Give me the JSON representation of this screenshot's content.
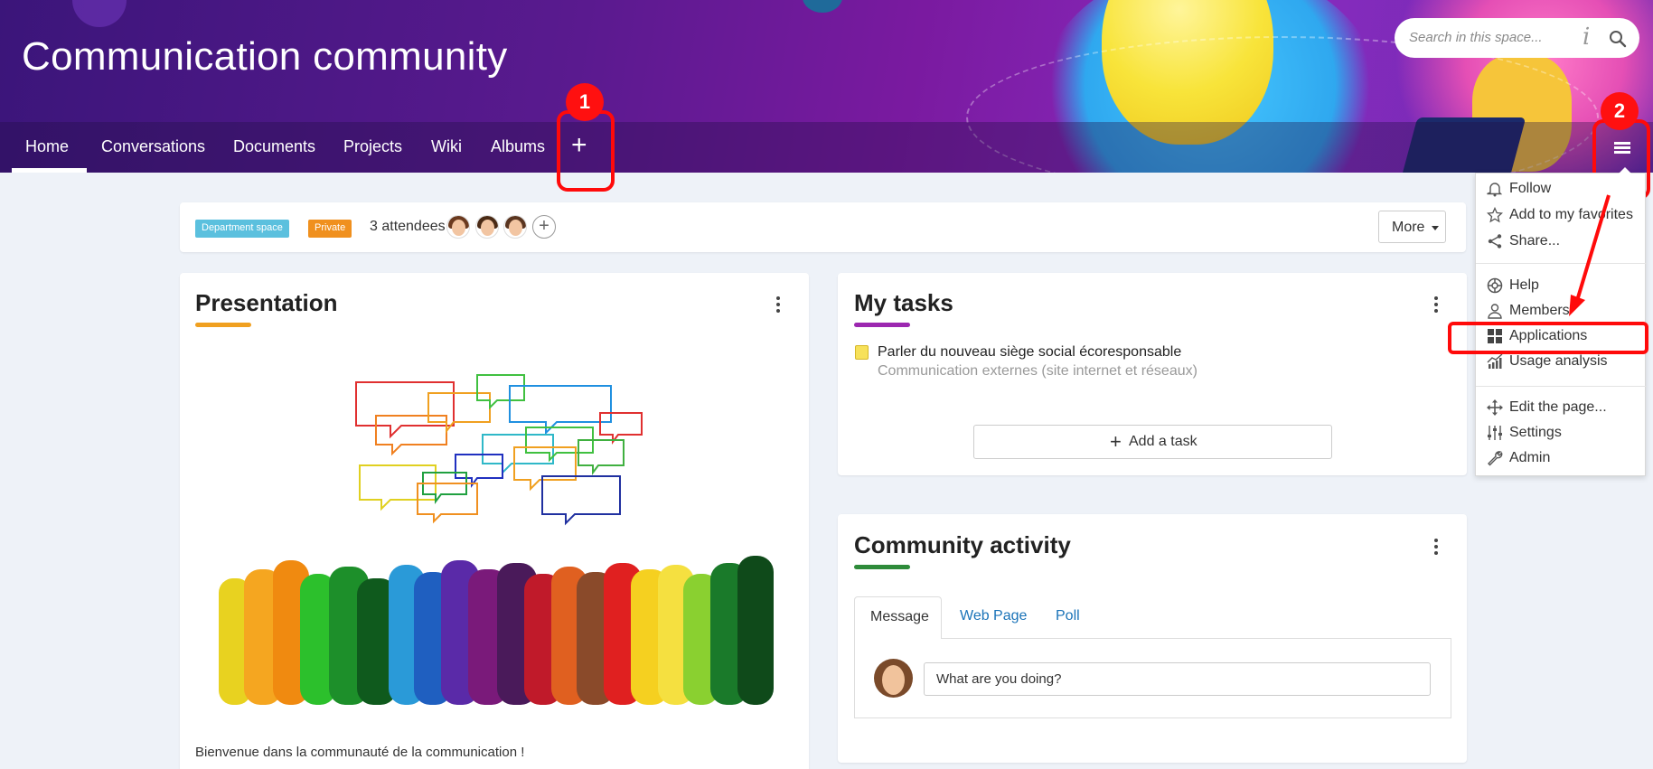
{
  "header": {
    "title": "Communication community",
    "search_placeholder": "Search in this space..."
  },
  "nav": {
    "tabs": [
      "Home",
      "Conversations",
      "Documents",
      "Projects",
      "Wiki",
      "Albums"
    ],
    "add_label": "+",
    "active": "Home"
  },
  "annotations": {
    "one": "1",
    "two": "2",
    "color": "#ff0a0a"
  },
  "info_bar": {
    "tags": [
      {
        "label": "Department space",
        "color": "#5bc0de"
      },
      {
        "label": "Private",
        "color": "#f0901e"
      }
    ],
    "attendees": "3 attendees",
    "add_attendee": "+",
    "more_label": "More"
  },
  "presentation": {
    "title": "Presentation",
    "underline_color": "#f0a020",
    "welcome": "Bienvenue dans la communauté de la communication !"
  },
  "tasks": {
    "title": "My tasks",
    "underline_color": "#9c27b0",
    "items": [
      {
        "title": "Parler du nouveau siège social écoresponsable",
        "subtitle": "Communication externes (site internet et réseaux)"
      }
    ],
    "add_label": "Add a task"
  },
  "activity": {
    "title": "Community activity",
    "underline_color": "#2e8b3a",
    "tabs": [
      "Message",
      "Web Page",
      "Poll"
    ],
    "compose_placeholder": "What are you doing?"
  },
  "menu": {
    "items": [
      {
        "label": "Follow",
        "icon": "bell-icon"
      },
      {
        "label": "Add to my favorites",
        "icon": "star-icon"
      },
      {
        "label": "Share...",
        "icon": "share-icon"
      },
      {
        "label": "Help",
        "icon": "lifebuoy-icon"
      },
      {
        "label": "Members",
        "icon": "person-icon"
      },
      {
        "label": "Applications",
        "icon": "grid-icon"
      },
      {
        "label": "Usage analysis",
        "icon": "chart-icon"
      },
      {
        "label": "Edit the page...",
        "icon": "move-icon"
      },
      {
        "label": "Settings",
        "icon": "sliders-icon"
      },
      {
        "label": "Admin",
        "icon": "wrench-icon"
      }
    ]
  },
  "colors": {
    "link": "#1a73b8",
    "accent": "#7a1aa0"
  }
}
